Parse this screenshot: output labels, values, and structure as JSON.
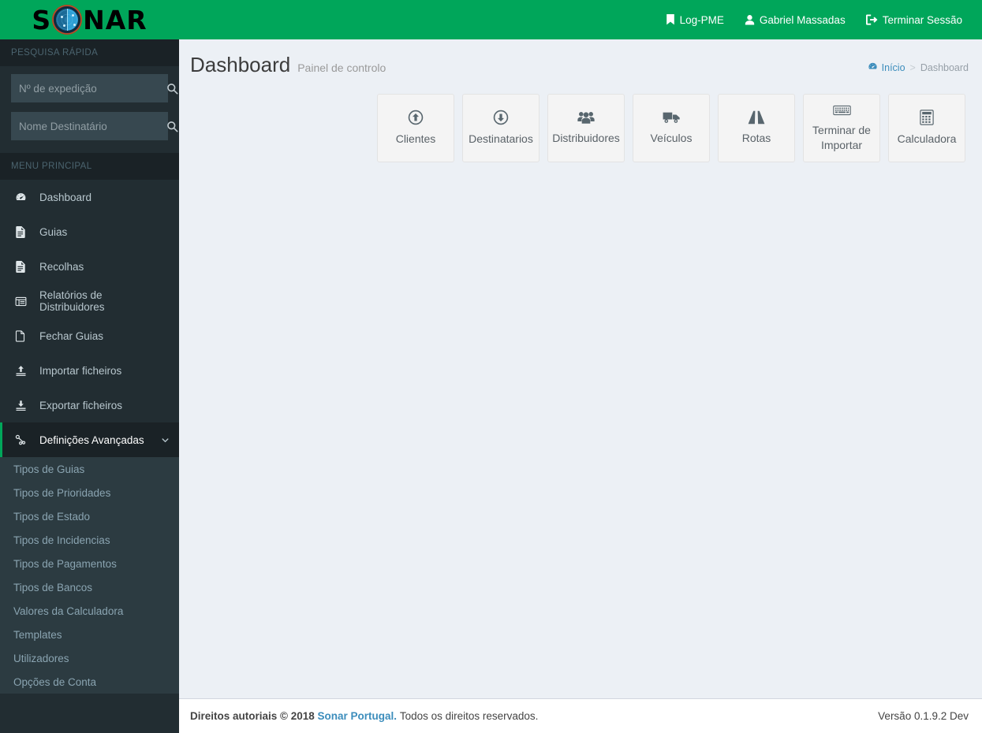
{
  "brand": {
    "logo_text_left": "S",
    "logo_text_right": "NAR",
    "logo_icon": "radar-icon",
    "header_color": "#00a65a",
    "sidebar_color": "#222d32",
    "link_color": "#3c8dbc"
  },
  "topbar": {
    "links": [
      {
        "label": "Log-PME",
        "icon": "bookmark-icon"
      },
      {
        "label": "Gabriel Massadas",
        "icon": "user-icon"
      },
      {
        "label": "Terminar Sessão",
        "icon": "sign-out-icon"
      }
    ]
  },
  "sidebar": {
    "quick_search_heading": "PESQUISA RÁPIDA",
    "search_fields": [
      {
        "placeholder": "Nº de expedição",
        "value": "",
        "icon": "search-icon"
      },
      {
        "placeholder": "Nome Destinatário",
        "value": "",
        "icon": "search-icon"
      }
    ],
    "menu_heading": "MENU PRINCIPAL",
    "items": [
      {
        "label": "Dashboard",
        "icon": "dashboard-icon"
      },
      {
        "label": "Guias",
        "icon": "file-text-icon"
      },
      {
        "label": "Recolhas",
        "icon": "file-text-icon"
      },
      {
        "label": "Relatórios de Distribuidores",
        "icon": "table-list-icon"
      },
      {
        "label": "Fechar Guias",
        "icon": "file-icon"
      },
      {
        "label": "Importar ficheiros",
        "icon": "upload-icon"
      },
      {
        "label": "Exportar ficheiros",
        "icon": "download-icon"
      }
    ],
    "advanced": {
      "label": "Definições Avançadas",
      "icon": "share-alt-icon",
      "chevron": "chevron-down-icon",
      "expanded": true,
      "items": [
        {
          "label": "Tipos de Guias"
        },
        {
          "label": "Tipos de Prioridades"
        },
        {
          "label": "Tipos de Estado"
        },
        {
          "label": "Tipos de Incidencias"
        },
        {
          "label": "Tipos de Pagamentos"
        },
        {
          "label": "Tipos de Bancos"
        },
        {
          "label": "Valores da Calculadora"
        },
        {
          "label": "Templates"
        },
        {
          "label": "Utilizadores"
        },
        {
          "label": "Opções de Conta"
        }
      ]
    }
  },
  "page": {
    "title": "Dashboard",
    "subtitle": "Painel de controlo",
    "breadcrumb": {
      "home_label": "Início",
      "home_icon": "dashboard-icon",
      "separator": ">",
      "current_label": "Dashboard"
    }
  },
  "tiles": [
    {
      "label": "Clientes",
      "icon": "arrow-up-circle-icon"
    },
    {
      "label": "Destinatarios",
      "icon": "arrow-down-circle-icon"
    },
    {
      "label": "Distribuidores",
      "icon": "users-icon"
    },
    {
      "label": "Veículos",
      "icon": "truck-icon"
    },
    {
      "label": "Rotas",
      "icon": "road-icon"
    },
    {
      "label": "Terminar de Importar",
      "icon": "keyboard-icon"
    },
    {
      "label": "Calculadora",
      "icon": "calculator-icon"
    }
  ],
  "footer": {
    "copyright_prefix": "Direitos autoriais © 2018",
    "company_link": "Sonar Portugal.",
    "rights_text": "Todos os direitos reservados.",
    "version": "Versão 0.1.9.2 Dev"
  }
}
